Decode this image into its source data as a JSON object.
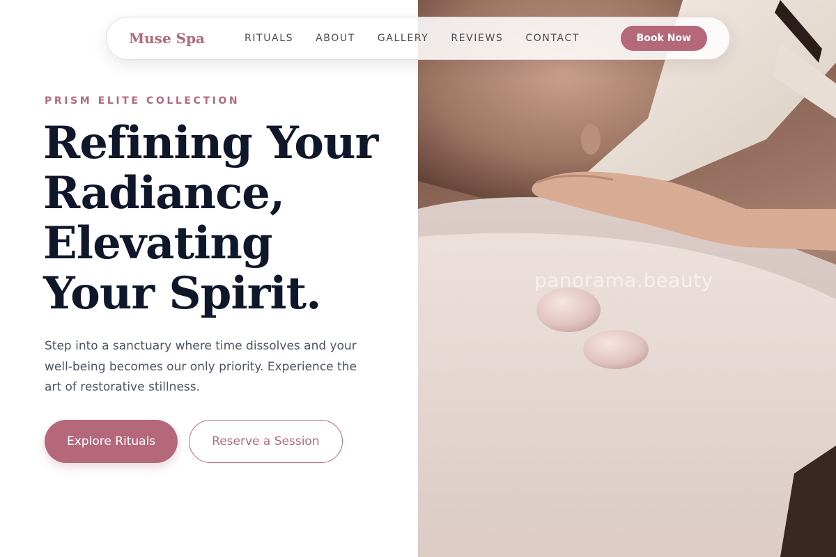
{
  "brand": {
    "name": "Muse Spa",
    "accent": "#b4687a"
  },
  "nav": {
    "links": [
      {
        "label": "RITUALS"
      },
      {
        "label": "ABOUT"
      },
      {
        "label": "GALLERY"
      },
      {
        "label": "REVIEWS"
      },
      {
        "label": "CONTACT"
      }
    ],
    "cta": "Book Now"
  },
  "hero": {
    "eyebrow": "PRISM ELITE COLLECTION",
    "headline_lines": [
      "Refining Your",
      "Radiance,",
      "Elevating",
      "Your Spirit."
    ],
    "lede": "Step into a sanctuary where time dissolves and your well-being becomes our only priority. Experience the art of restorative stillness.",
    "primary_cta": "Explore Rituals",
    "secondary_cta": "Reserve a Session"
  },
  "photo": {
    "watermark": "panorama.beauty"
  }
}
